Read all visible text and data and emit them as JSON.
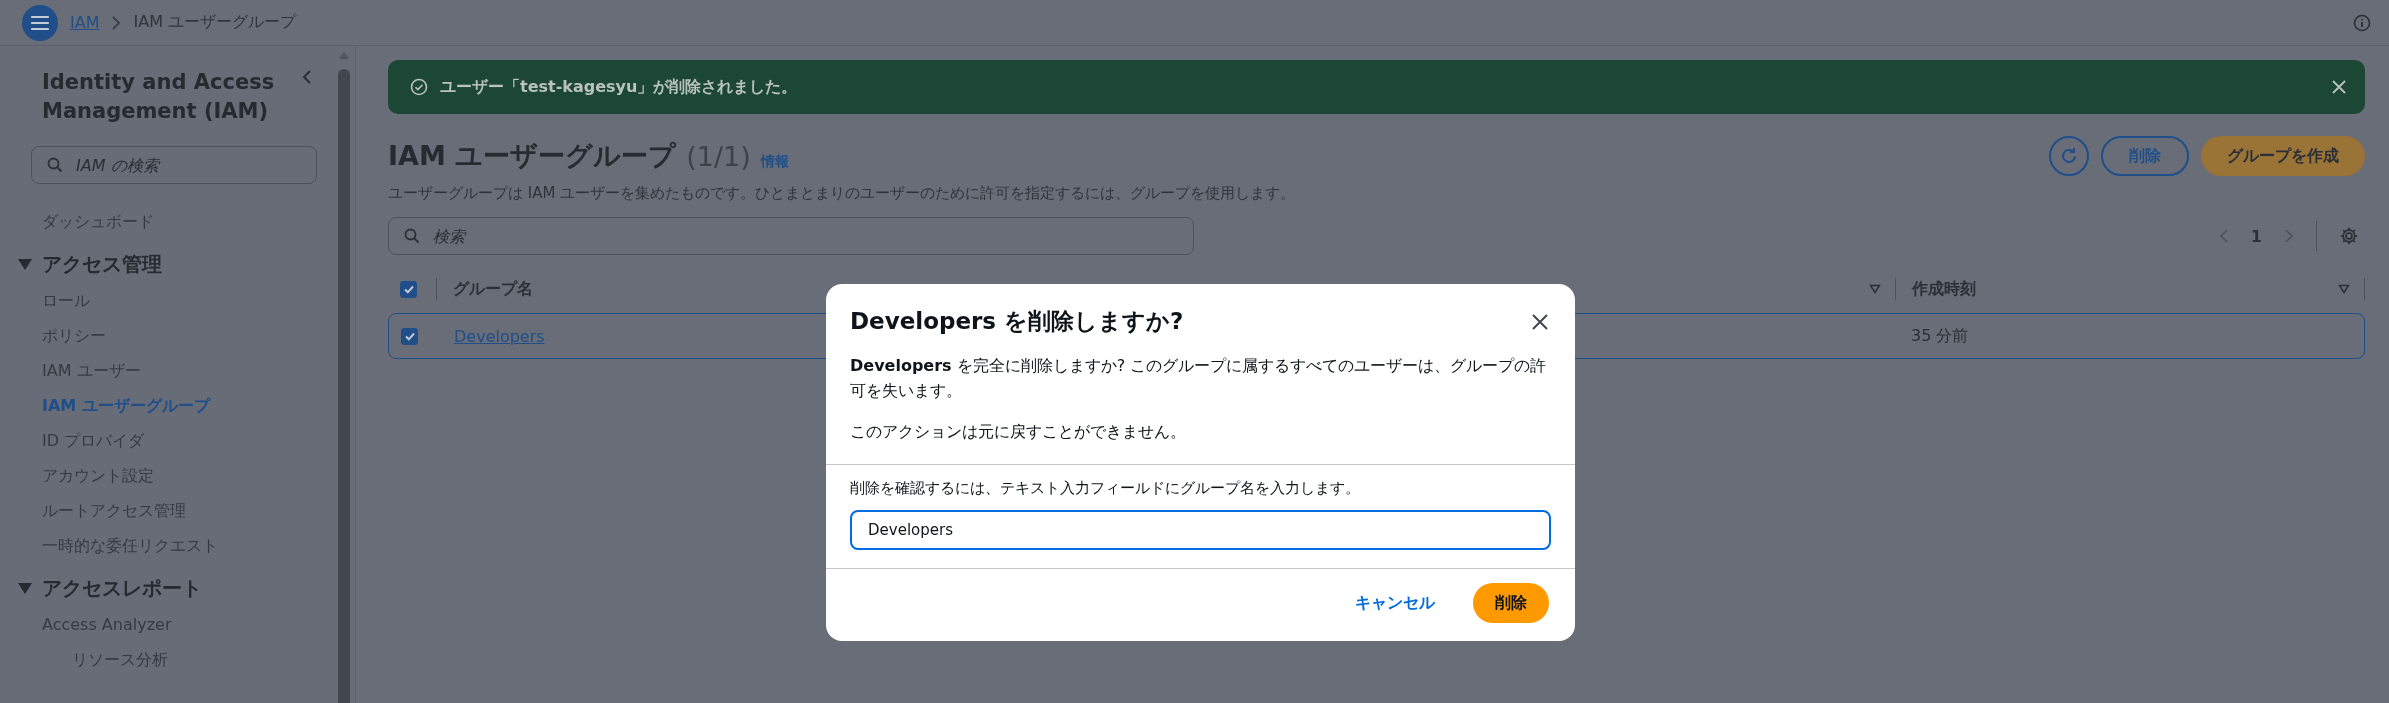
{
  "header": {
    "breadcrumbs": [
      {
        "label": "IAM",
        "link": true
      },
      {
        "label": "IAM ユーザーグループ",
        "link": false
      }
    ]
  },
  "sidebar": {
    "title": "Identity and Access Management (IAM)",
    "search": {
      "placeholder": "IAM の検索"
    },
    "items": [
      {
        "kind": "item",
        "label": "ダッシュボード",
        "selected": false
      },
      {
        "kind": "section",
        "label": "アクセス管理",
        "expanded": true,
        "children": [
          {
            "kind": "item",
            "label": "ロール",
            "selected": false
          },
          {
            "kind": "item",
            "label": "ポリシー",
            "selected": false
          },
          {
            "kind": "item",
            "label": "IAM ユーザー",
            "selected": false
          },
          {
            "kind": "item",
            "label": "IAM ユーザーグループ",
            "selected": true
          },
          {
            "kind": "item",
            "label": "ID プロバイダ",
            "selected": false
          },
          {
            "kind": "item",
            "label": "アカウント設定",
            "selected": false
          },
          {
            "kind": "item",
            "label": "ルートアクセス管理",
            "selected": false
          },
          {
            "kind": "item",
            "label": "一時的な委任リクエスト",
            "selected": false
          }
        ]
      },
      {
        "kind": "section",
        "label": "アクセスレポート",
        "expanded": true,
        "children": [
          {
            "kind": "item",
            "label": "Access Analyzer",
            "selected": false,
            "children": [
              {
                "kind": "item",
                "label": "リソース分析",
                "selected": false
              }
            ]
          }
        ]
      }
    ]
  },
  "banner": {
    "message": "ユーザー「test-kagesyu」が削除されました。"
  },
  "page": {
    "title": "IAM ユーザーグループ",
    "count": "(1/1)",
    "info": "情報",
    "description": "ユーザーグループは IAM ユーザーを集めたものです。ひとまとまりのユーザーのために許可を指定するには、グループを使用します。",
    "buttons": [
      {
        "kind": "secondary",
        "label": "削除"
      },
      {
        "kind": "primary",
        "label": "グループを作成"
      }
    ],
    "search": {
      "placeholder": "検索"
    },
    "pagination": {
      "page": "1"
    }
  },
  "table": {
    "all_checked": true,
    "columns": [
      {
        "label": "グループ名"
      },
      {
        "label": "作成時刻"
      }
    ],
    "rows": [
      {
        "selected": true,
        "name": "Developers",
        "created": "35 分前"
      }
    ]
  },
  "modal": {
    "title": "Developers を削除しますか?",
    "body": "**Developers** を完全に削除しますか? このグループに属するすべてのユーザーは、グループの許可を失います。",
    "warning": "このアクションは元に戻すことができません。",
    "confirm_label": "削除を確認するには、テキスト入力フィールドにグループ名を入力します。",
    "value": "Developers",
    "cancel": "キャンセル",
    "confirm": "削除"
  }
}
